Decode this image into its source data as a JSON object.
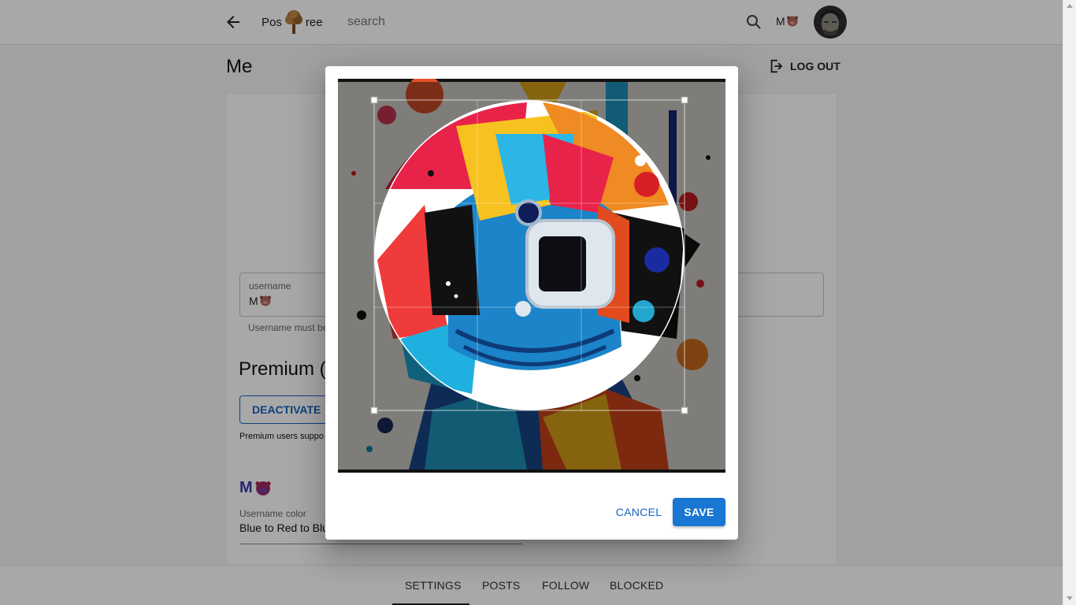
{
  "header": {
    "brand_left": "Pos",
    "brand_right": "ree",
    "brand_icon": "tree-icon",
    "search_placeholder": "search",
    "username": "M",
    "username_icon": "pig-face-icon"
  },
  "page": {
    "title": "Me",
    "logout_label": "LOG OUT"
  },
  "settings": {
    "username_label": "username",
    "username_value": "M",
    "username_help": "Username must be",
    "premium_title": "Premium (",
    "deactivate_label": "DEACTIVATE",
    "premium_note": "Premium users suppo",
    "colored_name": "M",
    "username_color_label": "Username color",
    "username_color_value": "Blue to Red to Blu"
  },
  "tabs": [
    {
      "label": "SETTINGS",
      "active": true
    },
    {
      "label": "POSTS",
      "active": false
    },
    {
      "label": "FOLLOW",
      "active": false
    },
    {
      "label": "BLOCKED",
      "active": false
    }
  ],
  "dialog": {
    "image_subject": "astronaut-helmet-artwork",
    "cancel_label": "CANCEL",
    "save_label": "SAVE"
  },
  "colors": {
    "primary": "#1976d2",
    "primary_text": "#1565c0",
    "backdrop": "rgba(0,0,0,0.34)"
  }
}
